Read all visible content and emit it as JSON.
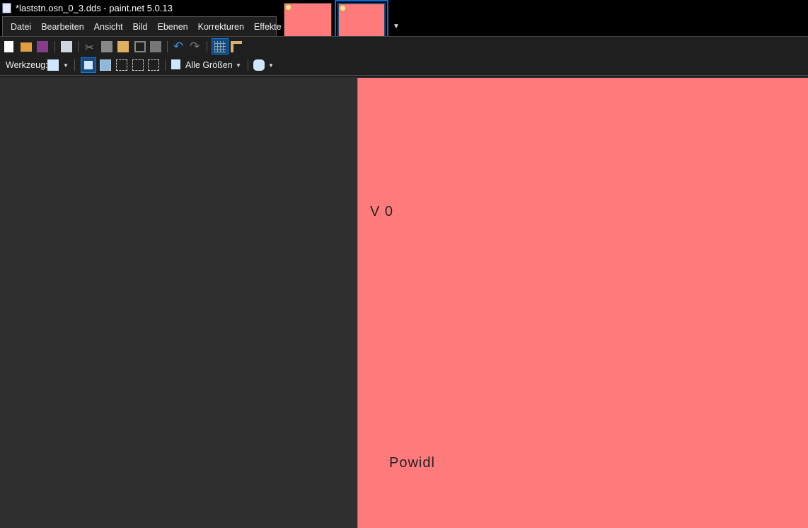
{
  "window": {
    "title": "*laststn.osn_0_3.dds - paint.net 5.0.13"
  },
  "menu": [
    "Datei",
    "Bearbeiten",
    "Ansicht",
    "Bild",
    "Ebenen",
    "Korrekturen",
    "Effekte"
  ],
  "toolbar": {
    "tool_label": "Werkzeug:",
    "size_label": "Alle Größen"
  },
  "image": {
    "text1": "V  0",
    "text2": "Powidl",
    "background_color": "#ff7b7b"
  }
}
